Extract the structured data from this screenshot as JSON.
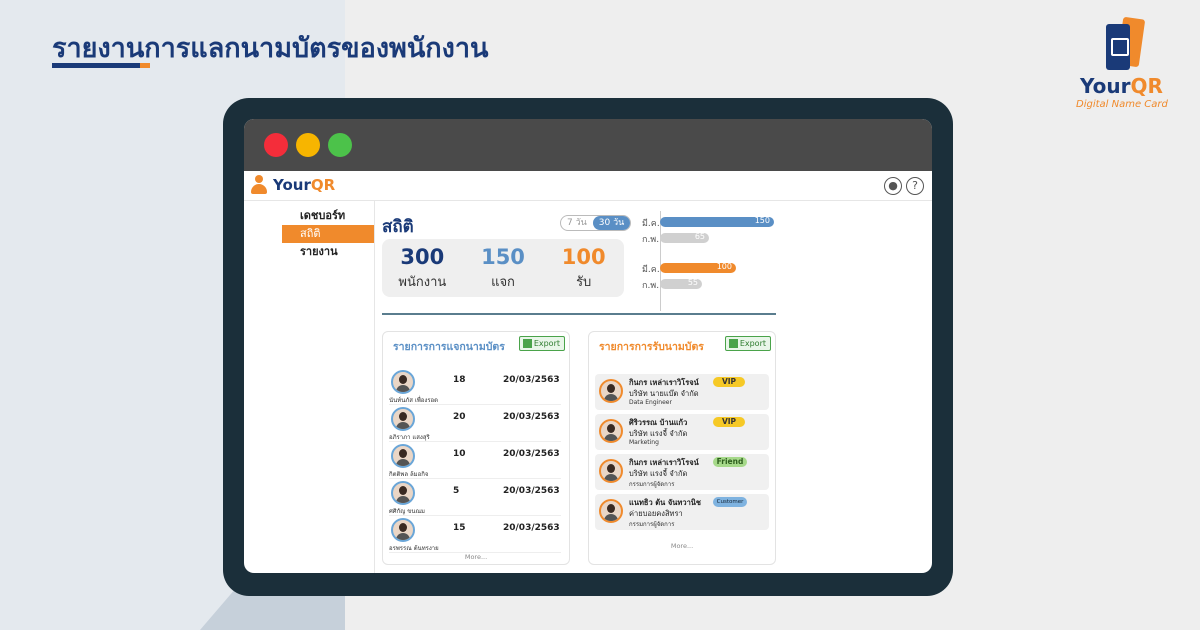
{
  "page": {
    "title": "รายงานการแลกนามบัตรของพนักงาน"
  },
  "brand": {
    "name_main": "Your",
    "name_accent": "QR",
    "tagline": "Digital Name Card"
  },
  "colors": {
    "navy": "#1a3a78",
    "orange": "#f08a2c",
    "blue": "#5a8fc5",
    "device": "#1b2f3a"
  },
  "app": {
    "logo_main": "Your",
    "logo_accent": "QR",
    "header_icons": [
      "user-icon",
      "help-icon"
    ],
    "sidebar": [
      {
        "label": "เดชบอร์ท",
        "active": false
      },
      {
        "label": "สถิติ",
        "active": true
      },
      {
        "label": "รายงาน",
        "active": false
      }
    ],
    "stats": {
      "title": "สถิติ",
      "ranges": [
        {
          "label": "7 วัน",
          "active": false
        },
        {
          "label": "30 วัน",
          "active": true
        }
      ],
      "items": [
        {
          "value": "300",
          "label": "พนักงาน",
          "color": "#1a3a78"
        },
        {
          "value": "150",
          "label": "แจก",
          "color": "#5a8fc5"
        },
        {
          "value": "100",
          "label": "รับ",
          "color": "#f08a2c"
        }
      ]
    },
    "bar_chart": {
      "max": 150,
      "rows": [
        {
          "label": "มี.ค.",
          "value": 150,
          "color": "#5a8fc5"
        },
        {
          "label": "ก.พ.",
          "value": 65,
          "color": "#d0d0d0"
        },
        {
          "label": "มี.ค.",
          "value": 100,
          "color": "#f08a2c"
        },
        {
          "label": "ก.พ.",
          "value": 55,
          "color": "#d0d0d0"
        }
      ]
    },
    "given": {
      "title": "รายการการแจกนามบัตร",
      "export_label": "Export",
      "rows": [
        {
          "name": "นันท์นภัส เพื่องรอด",
          "count": "18",
          "date": "20/03/2563"
        },
        {
          "name": "อภิราภา แสงสุริ",
          "count": "20",
          "date": "20/03/2563"
        },
        {
          "name": "กิตติพล ล้มอกิจ",
          "count": "10",
          "date": "20/03/2563"
        },
        {
          "name": "ศศิกัญ ขนณม",
          "count": "5",
          "date": "20/03/2563"
        },
        {
          "name": "อรพรรณ ต้นทรงาย",
          "count": "15",
          "date": "20/03/2563"
        }
      ],
      "more_label": "More..."
    },
    "received": {
      "title": "รายการการรับนามบัตร",
      "export_label": "Export",
      "rows": [
        {
          "name": "กินกร เหล่าเราวิโรจน์",
          "company": "บริษัท นายแบ๊ต จำกัด",
          "position": "Data Engineer",
          "tag": "VIP",
          "tag_type": "vip"
        },
        {
          "name": "ศิริวรรณ บ้านแก้ว",
          "company": "บริษัท แรงจี้ จำกัด",
          "position": "Marketing",
          "tag": "VIP",
          "tag_type": "vip"
        },
        {
          "name": "กินกร เหล่าเราวิโรจน์",
          "company": "บริษัท แรงจี้ จำกัด",
          "position": "กรรมการผู้จัดการ",
          "tag": "Friend",
          "tag_type": "friend"
        },
        {
          "name": "แนทธิว ต้น จันทวานิช",
          "company": "ค่ายบอยคงสิทรา",
          "position": "กรรมการผู้จัดการ",
          "tag": "Customer",
          "tag_type": "customer"
        }
      ],
      "more_label": "More..."
    }
  }
}
